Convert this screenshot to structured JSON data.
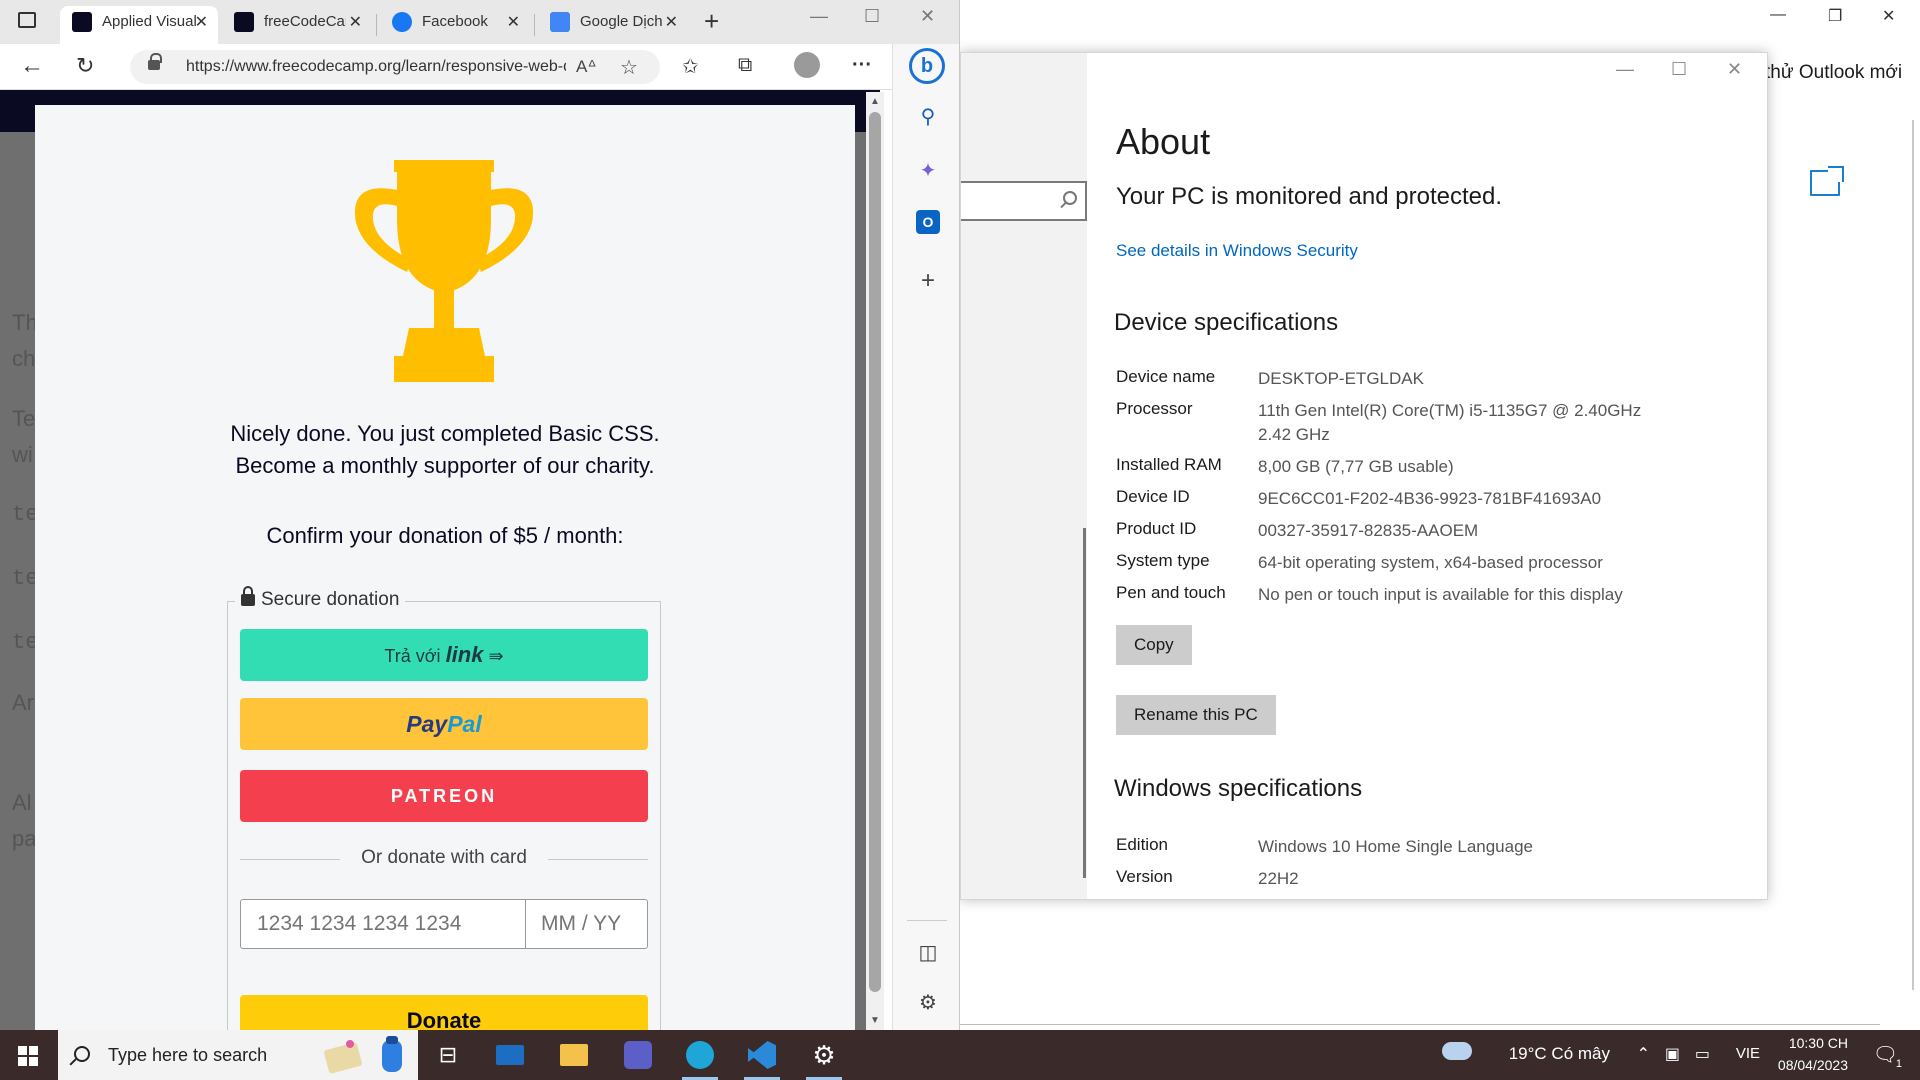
{
  "browser": {
    "tabs": [
      {
        "label": "Applied Visual Design",
        "active": true,
        "favicon": "freecodecamp-icon"
      },
      {
        "label": "freeCodeCamp",
        "active": false,
        "favicon": "freecodecamp-icon"
      },
      {
        "label": "Facebook",
        "active": false,
        "favicon": "facebook-icon"
      },
      {
        "label": "Google Dịch",
        "active": false,
        "favicon": "google-translate-icon"
      }
    ],
    "url": "https://www.freecodecamp.org/learn/responsive-web-design/",
    "page_fragments": [
      "Th",
      "ch",
      "Te",
      "wi",
      "te",
      "te",
      "te",
      "Ar",
      "Al",
      "pa"
    ]
  },
  "modal": {
    "line1": "Nicely done. You just completed Basic CSS.",
    "line2": "Become a monthly supporter of our charity.",
    "confirm": "Confirm your donation of $5 / month:",
    "secure_label": "Secure donation",
    "link_prefix": "Trả với",
    "link_brand": "link",
    "link_arrow": "⇛",
    "paypal_a": "Pay",
    "paypal_b": "Pal",
    "patreon": "PATREON",
    "or_card": "Or donate with card",
    "card_placeholder": "1234 1234 1234 1234",
    "expiry_placeholder": "MM / YY",
    "donate": "Donate",
    "trophy_color": "#ffbf00"
  },
  "settings": {
    "title": "About",
    "protected": "Your PC is monitored and protected.",
    "security_link": "See details in Windows Security",
    "device_heading": "Device specifications",
    "specs": [
      {
        "key": "Device name",
        "value": "DESKTOP-ETGLDAK"
      },
      {
        "key": "Processor",
        "value": "11th Gen Intel(R) Core(TM) i5-1135G7 @ 2.40GHz",
        "value2": "2.42 GHz"
      },
      {
        "key": "Installed RAM",
        "value": "8,00 GB (7,77 GB usable)"
      },
      {
        "key": "Device ID",
        "value": "9EC6CC01-F202-4B36-9923-781BF41693A0"
      },
      {
        "key": "Product ID",
        "value": "00327-35917-82835-AAOEM"
      },
      {
        "key": "System type",
        "value": "64-bit operating system, x64-based processor"
      },
      {
        "key": "Pen and touch",
        "value": "No pen or touch input is available for this display"
      }
    ],
    "copy_button": "Copy",
    "rename_button": "Rename this PC",
    "windows_heading": "Windows specifications",
    "win_specs": [
      {
        "key": "Edition",
        "value": "Windows 10 Home Single Language"
      },
      {
        "key": "Version",
        "value": "22H2"
      }
    ]
  },
  "background_window": {
    "outlook_text": "thử Outlook mới"
  },
  "taskbar": {
    "search_placeholder": "Type here to search",
    "weather": "19°C  Có mây",
    "language": "VIE",
    "time": "10:30 CH",
    "date": "08/04/2023",
    "notification_count": "1"
  },
  "colors": {
    "accent_link": "#0067c0",
    "taskbar": "#3b2a2a",
    "link_button": "#33ddb3",
    "paypal_button": "#ffc43a",
    "patreon_button": "#f43f4f",
    "donate_button": "#fecc09"
  }
}
